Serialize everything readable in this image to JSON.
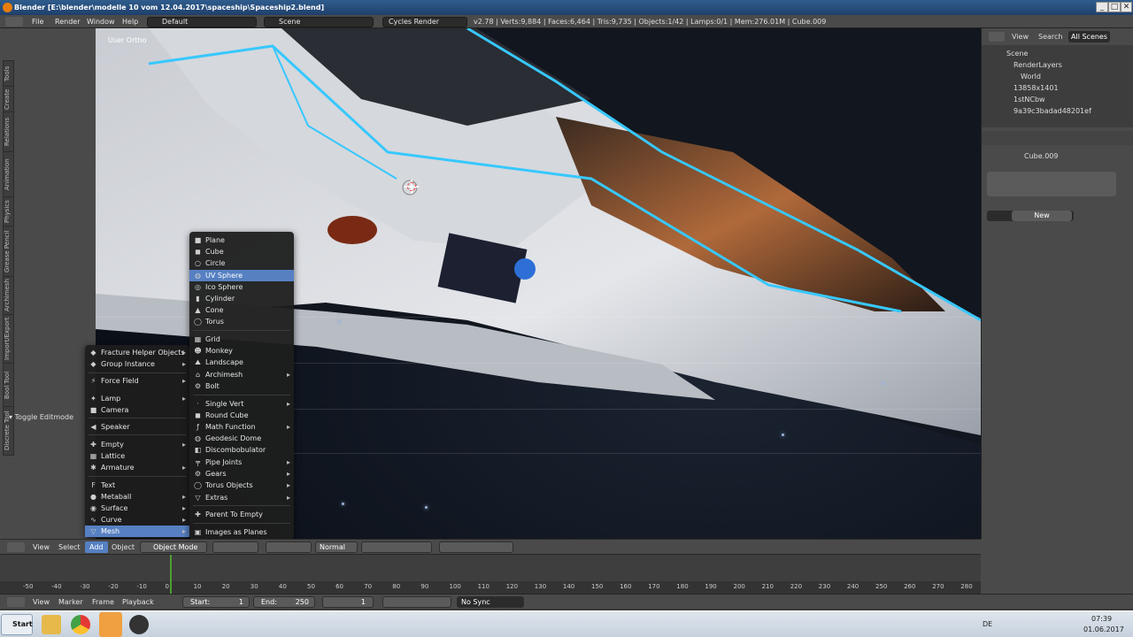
{
  "window": {
    "title": "Blender [E:\\blender\\modelle 10 vom 12.04.2017\\spaceship\\Spaceship2.blend]",
    "min": "_",
    "max": "□",
    "close": "✕"
  },
  "infobar": {
    "menus": [
      "File",
      "Render",
      "Window",
      "Help"
    ],
    "layout": "Default",
    "scene": "Scene",
    "engine": "Cycles Render",
    "stats": "v2.78 | Verts:9,884 | Faces:6,464 | Tris:9,735 | Objects:1/42 | Lamps:0/1 | Mem:276.01M | Cube.009"
  },
  "toolshelf": {
    "tabs": [
      "Tools",
      "Create",
      "Relations",
      "Animation",
      "Physics",
      "Grease Pencil",
      "Archimesh",
      "Import/Export",
      "Bool Tool",
      "Discrete Tool"
    ],
    "toggle_editmode": "Toggle Editmode"
  },
  "viewport": {
    "label": "User Ortho"
  },
  "add_menu": {
    "items": [
      {
        "label": "Fracture Helper Objects",
        "icon": "◆",
        "arrow": "▸"
      },
      {
        "label": "Group Instance",
        "icon": "◆",
        "arrow": "▸"
      },
      {
        "label": "Force Field",
        "icon": "⚡",
        "arrow": "▸"
      },
      {
        "label": "Lamp",
        "icon": "✦",
        "arrow": "▸"
      },
      {
        "label": "Camera",
        "icon": "■",
        "arrow": ""
      },
      {
        "label": "Speaker",
        "icon": "◀",
        "arrow": ""
      },
      {
        "label": "Empty",
        "icon": "✚",
        "arrow": "▸"
      },
      {
        "label": "Lattice",
        "icon": "▦",
        "arrow": ""
      },
      {
        "label": "Armature",
        "icon": "✱",
        "arrow": "▸"
      },
      {
        "label": "Text",
        "icon": "F",
        "arrow": ""
      },
      {
        "label": "Metaball",
        "icon": "●",
        "arrow": "▸"
      },
      {
        "label": "Surface",
        "icon": "◉",
        "arrow": "▸"
      },
      {
        "label": "Curve",
        "icon": "∿",
        "arrow": "▸"
      },
      {
        "label": "Mesh",
        "icon": "▽",
        "arrow": "▸"
      }
    ]
  },
  "mesh_menu": {
    "items": [
      {
        "label": "Plane",
        "icon": "■",
        "arrow": ""
      },
      {
        "label": "Cube",
        "icon": "◼",
        "arrow": ""
      },
      {
        "label": "Circle",
        "icon": "○",
        "arrow": ""
      },
      {
        "label": "UV Sphere",
        "icon": "◍",
        "arrow": ""
      },
      {
        "label": "Ico Sphere",
        "icon": "◎",
        "arrow": ""
      },
      {
        "label": "Cylinder",
        "icon": "▮",
        "arrow": ""
      },
      {
        "label": "Cone",
        "icon": "▲",
        "arrow": ""
      },
      {
        "label": "Torus",
        "icon": "◯",
        "arrow": ""
      },
      {
        "label": "Grid",
        "icon": "▦",
        "arrow": ""
      },
      {
        "label": "Monkey",
        "icon": "☻",
        "arrow": ""
      },
      {
        "label": "Landscape",
        "icon": "⛰",
        "arrow": ""
      },
      {
        "label": "Archimesh",
        "icon": "⌂",
        "arrow": "▸"
      },
      {
        "label": "Bolt",
        "icon": "⚙",
        "arrow": ""
      },
      {
        "label": "Single Vert",
        "icon": "·",
        "arrow": "▸"
      },
      {
        "label": "Round Cube",
        "icon": "◼",
        "arrow": ""
      },
      {
        "label": "Math Function",
        "icon": "ƒ",
        "arrow": "▸"
      },
      {
        "label": "Geodesic Dome",
        "icon": "◍",
        "arrow": ""
      },
      {
        "label": "Discombobulator",
        "icon": "◧",
        "arrow": ""
      },
      {
        "label": "Pipe Joints",
        "icon": "╤",
        "arrow": "▸"
      },
      {
        "label": "Gears",
        "icon": "⚙",
        "arrow": "▸"
      },
      {
        "label": "Torus Objects",
        "icon": "◯",
        "arrow": "▸"
      },
      {
        "label": "Extras",
        "icon": "▽",
        "arrow": "▸"
      },
      {
        "label": "Parent To Empty",
        "icon": "✚",
        "arrow": ""
      },
      {
        "label": "Images as Planes",
        "icon": "▣",
        "arrow": ""
      }
    ]
  },
  "vp_header": {
    "view": "View",
    "select": "Select",
    "add": "Add",
    "object": "Object",
    "mode": "Object Mode",
    "orientation": "Normal"
  },
  "outliner": {
    "view": "View",
    "search": "Search",
    "filter": "All Scenes",
    "rows": [
      "Scene",
      "RenderLayers",
      "World",
      "13858x1401",
      "1stNCbw",
      "9a39c3badad48201ef"
    ]
  },
  "properties": {
    "object": "Cube.009",
    "new": "New"
  },
  "timeline": {
    "ticks": [
      "-50",
      "-40",
      "-30",
      "-20",
      "-10",
      "0",
      "10",
      "20",
      "30",
      "40",
      "50",
      "60",
      "70",
      "80",
      "90",
      "100",
      "110",
      "120",
      "130",
      "140",
      "150",
      "160",
      "170",
      "180",
      "190",
      "200",
      "210",
      "220",
      "230",
      "240",
      "250",
      "260",
      "270",
      "280"
    ],
    "view": "View",
    "marker": "Marker",
    "frame": "Frame",
    "playback": "Playback",
    "start_label": "Start:",
    "start": "1",
    "end_label": "End:",
    "end": "250",
    "current": "1",
    "sync": "No Sync"
  },
  "taskbar": {
    "start": "Start",
    "lang": "DE",
    "time": "07:39",
    "date": "01.06.2017"
  }
}
